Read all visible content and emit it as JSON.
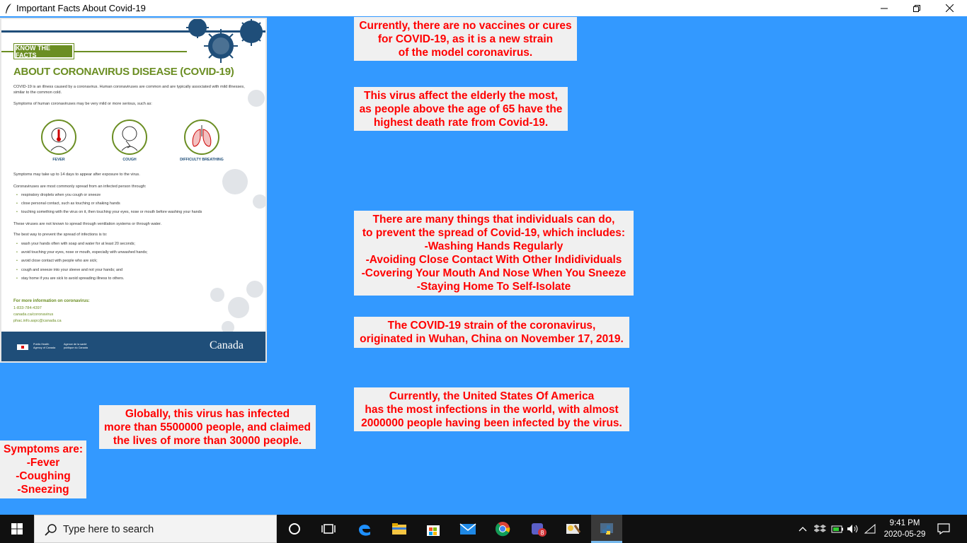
{
  "window": {
    "title": "Important Facts About Covid-19",
    "controls": {
      "minimize": "minimize",
      "maximize": "restore",
      "close": "close"
    }
  },
  "poster": {
    "tag": "KNOW THE FACTS",
    "title": "ABOUT CORONAVIRUS DISEASE (COVID-19)",
    "intro1": "COVID-19 is an illness caused by a coronavirus. Human coronaviruses are common and are typically associated with mild illnesses, similar to the common cold.",
    "intro2": "Symptoms of human coronaviruses may be very mild or more serious, such as:",
    "symptoms": [
      "FEVER",
      "COUGH",
      "DIFFICULTY BREATHING"
    ],
    "delay": "Symptoms may take up to 14 days to appear after exposure to the virus.",
    "spread_intro": "Coronaviruses are most commonly spread from an infected person through:",
    "spread": [
      "respiratory droplets when you cough or sneeze",
      "close personal contact, such as touching or shaking hands",
      "touching something with the virus on it, then touching your eyes, nose or mouth before washing your hands"
    ],
    "ventilation": "These viruses are not known to spread through ventilation systems or through water.",
    "prevent_intro": "The best way to prevent the spread of infections is to:",
    "prevent": [
      "wash your hands often with soap and water for at least 20 seconds;",
      "avoid touching your eyes, nose or mouth, especially with unwashed hands;",
      "avoid close contact with people who are sick;",
      "cough and sneeze into your sleeve and not your hands; and",
      "stay home if you are sick to avoid spreading illness to others."
    ],
    "info_head": "For more information on coronavirus:",
    "info": [
      "1-833-784-4397",
      "canada.ca/coronavirus",
      "phac.info.aspc@canada.ca"
    ],
    "agency_en": "Public Health\nAgency of Canada",
    "agency_fr": "Agence de la santé\npublique du Canada",
    "wordmark": "Canada"
  },
  "facts": {
    "vaccines": "Currently, there are no vaccines or cures\nfor COVID-19, as it is a new strain\nof the model coronavirus.",
    "elderly": "This virus affect the elderly the most,\nas people above the age of 65 have the\nhighest death rate from Covid-19.",
    "prevention": "There are many things that individuals can do,\nto prevent the spread of Covid-19, which includes:\n-Washing Hands Regularly\n-Avoiding Close Contact With Other Indidividuals\n-Covering Your Mouth And Nose When You Sneeze\n-Staying Home To Self-Isolate",
    "origin": "The COVID-19 strain of the coronavirus,\noriginated in Wuhan, China on November 17, 2019.",
    "usa": "Currently, the United States Of America\nhas the most infections in the world, with almost\n2000000 people having been infected by the virus.",
    "global": "Globally, this virus has infected\nmore than 5500000 people, and claimed\nthe lives of more than 30000 people.",
    "symptoms": "Symptoms are:\n-Fever\n-Coughing\n-Sneezing"
  },
  "taskbar": {
    "search_placeholder": "Type here to search",
    "time": "9:41 PM",
    "date": "2020-05-29",
    "teams_badge": "8",
    "apps": [
      "cortana-icon",
      "task-view-icon",
      "edge-icon",
      "file-explorer-icon",
      "store-icon",
      "mail-icon",
      "chrome-icon",
      "teams-icon",
      "paint-icon",
      "python-icon"
    ]
  },
  "colors": {
    "background": "#3399ff",
    "fact_text": "#ff0000",
    "fact_bg": "#f0f0f0",
    "taskbar": "#101010"
  }
}
